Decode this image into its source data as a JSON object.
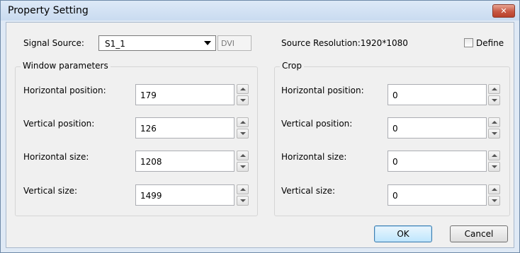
{
  "window": {
    "title": "Property Setting",
    "close_label": "✕"
  },
  "source": {
    "signal_label": "Signal Source:",
    "signal_value": "S1_1",
    "interface": "DVI",
    "resolution_text": "Source Resolution:1920*1080",
    "define_label": "Define",
    "define_checked": false
  },
  "window_params": {
    "title": "Window parameters",
    "rows": [
      {
        "label": "Horizontal position:",
        "value": "179"
      },
      {
        "label": "Vertical position:",
        "value": "126"
      },
      {
        "label": "Horizontal size:",
        "value": "1208"
      },
      {
        "label": "Vertical size:",
        "value": "1499"
      }
    ]
  },
  "crop": {
    "title": "Crop",
    "rows": [
      {
        "label": "Horizontal position:",
        "value": "0"
      },
      {
        "label": "Vertical position:",
        "value": "0"
      },
      {
        "label": "Horizontal size:",
        "value": "0"
      },
      {
        "label": "Vertical size:",
        "value": "0"
      }
    ]
  },
  "buttons": {
    "ok": "OK",
    "cancel": "Cancel"
  }
}
